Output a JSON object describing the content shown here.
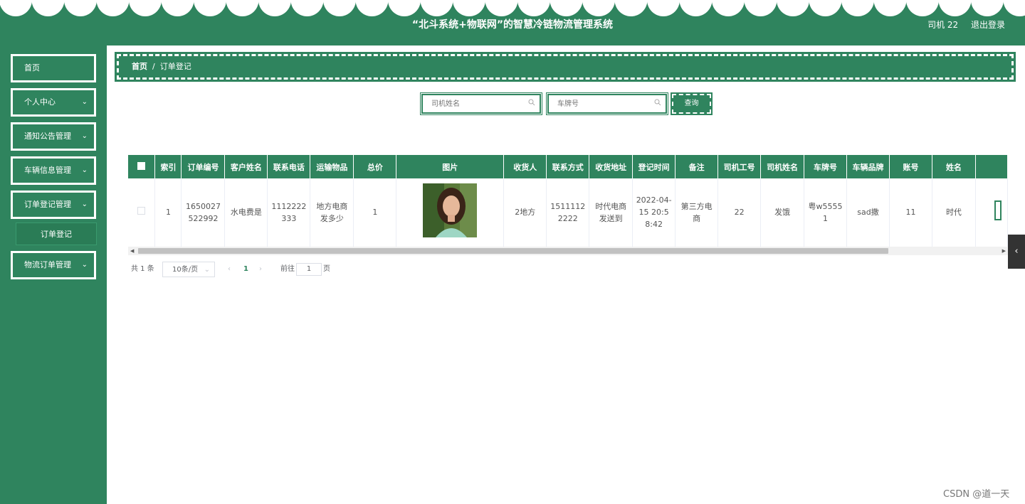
{
  "header": {
    "title": "“北斗系统+物联网”的智慧冷链物流管理系统",
    "user": "司机 22",
    "logout": "退出登录",
    "colors": {
      "primary": "#2f845e",
      "text_light": "#ffffff"
    }
  },
  "sidebar": {
    "items": [
      {
        "label": "首页",
        "has_arrow": false
      },
      {
        "label": "个人中心",
        "has_arrow": true
      },
      {
        "label": "通知公告管理",
        "has_arrow": true
      },
      {
        "label": "车辆信息管理",
        "has_arrow": true
      },
      {
        "label": "订单登记管理",
        "has_arrow": true,
        "expanded": true
      },
      {
        "label": "订单登记",
        "is_sub": true
      },
      {
        "label": "物流订单管理",
        "has_arrow": true
      }
    ]
  },
  "breadcrumb": {
    "home": "首页",
    "separator": "/",
    "current": "订单登记"
  },
  "search": {
    "driver_placeholder": "司机姓名",
    "plate_placeholder": "车牌号",
    "query_label": "查询"
  },
  "table": {
    "columns": [
      "索引",
      "订单编号",
      "客户姓名",
      "联系电话",
      "运输物品",
      "总价",
      "图片",
      "收货人",
      "联系方式",
      "收货地址",
      "登记时间",
      "备注",
      "司机工号",
      "司机姓名",
      "车牌号",
      "车辆品牌",
      "账号",
      "姓名"
    ],
    "rows": [
      [
        "1",
        "1650027522992",
        "水电费是",
        "1112222333",
        "地方电商发多少",
        "1",
        "",
        "2地方",
        "15111122222",
        "时代电商发送到",
        "2022-04-15 20:58:42",
        "第三方电商",
        "22",
        "发饿",
        "粤w55551",
        "sad撒",
        "11",
        "时代"
      ]
    ]
  },
  "pagination": {
    "total": "共 1 条",
    "page_size": "10条/页",
    "current_page": "1",
    "goto_label": "前往",
    "goto_value": "1",
    "page_suffix": "页",
    "prev": "‹",
    "next": "›"
  },
  "icons": {
    "search": "search-icon",
    "chevron": "chevron-down-icon",
    "collapse": "chevron-left-icon"
  },
  "side_tab": "‹",
  "watermark": "CSDN @道一天"
}
